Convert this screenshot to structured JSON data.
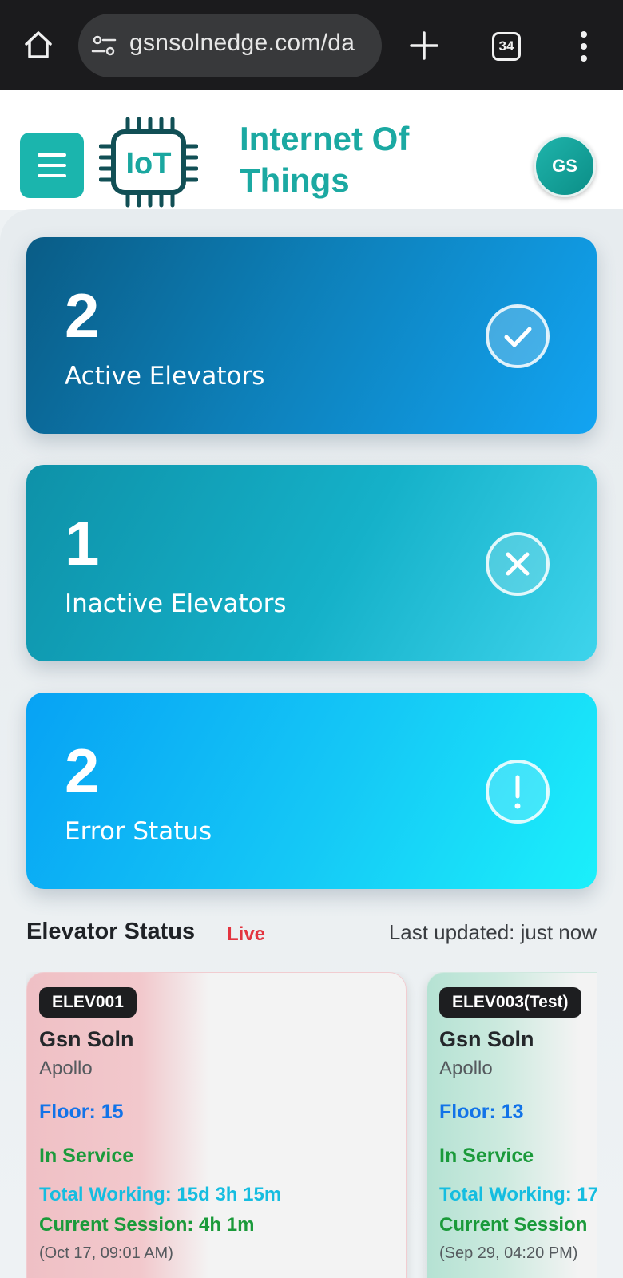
{
  "browser": {
    "url": "gsnsolnedge.com/da",
    "tab_count": "34",
    "icons": [
      "home-icon",
      "site-info-icon",
      "new-tab-icon",
      "tab-switcher-icon",
      "more-vert-icon"
    ]
  },
  "header": {
    "logo_text": "IoT",
    "title": "Internet Of Things",
    "avatar_initials": "GS",
    "accent_color": "#1bb5ad"
  },
  "summary_cards": [
    {
      "value": "2",
      "label": "Active Elevators",
      "icon": "check-circle-icon"
    },
    {
      "value": "1",
      "label": "Inactive Elevators",
      "icon": "x-circle-icon"
    },
    {
      "value": "2",
      "label": "Error Status",
      "icon": "alert-circle-icon"
    }
  ],
  "elevator_status": {
    "title": "Elevator Status",
    "live_label": "Live",
    "last_updated": "Last updated: just now",
    "elevators": [
      {
        "id": "ELEV001",
        "building": "Gsn Soln",
        "location": "Apollo",
        "floor": "Floor: 15",
        "status": "In Service",
        "total_working": "Total Working: 15d 3h 15m",
        "current_session": "Current Session: 4h 1m",
        "session_start": "(Oct 17, 09:01 AM)"
      },
      {
        "id": "ELEV003(Test)",
        "building": "Gsn Soln",
        "location": "Apollo",
        "floor": "Floor: 13",
        "status": "In Service",
        "total_working": "Total Working: 17",
        "current_session": "Current Session",
        "session_start": "(Sep 29, 04:20 PM)"
      }
    ]
  }
}
